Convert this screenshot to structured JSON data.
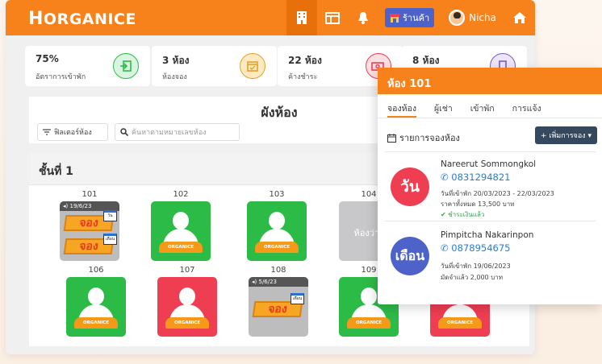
{
  "app": {
    "logo_h": "H",
    "logo_rest": "ORGANICE"
  },
  "nav": {
    "shop_label": "ร้านค้า",
    "user_name": "Nicha"
  },
  "stats": [
    {
      "value": "75%",
      "label": "อัตราการเข้าพัก",
      "color": "#2dbb47"
    },
    {
      "value": "3 ห้อง",
      "label": "ห้องจอง",
      "color": "#e5a21c"
    },
    {
      "value": "22 ห้อง",
      "label": "ค้างชำระ",
      "color": "#ef3d52"
    },
    {
      "value": "8 ห้อง",
      "label": "",
      "color": "#7b5cc4"
    }
  ],
  "plan": {
    "title": "ผังห้อง",
    "filter_label": "ฟิลเตอร์ห้อง",
    "search_placeholder": "ค้นหาตามหมายเลขห้อง"
  },
  "floor": {
    "title": "ชั้นที่ 1"
  },
  "rooms": [
    {
      "num": "101",
      "status": "booked",
      "date": "19/6/23",
      "booking_1": "จอง",
      "cal_1": "วัน",
      "booking_2": "จอง",
      "cal_2": "เดือน"
    },
    {
      "num": "102",
      "status": "occupied",
      "badge": "ORGANICE"
    },
    {
      "num": "103",
      "status": "occupied",
      "badge": "ORGANICE"
    },
    {
      "num": "104",
      "status": "vacant",
      "label": "ห้องว่าง"
    },
    {
      "num": "106",
      "status": "occupied",
      "badge": "ORGANICE"
    },
    {
      "num": "107",
      "status": "overdue",
      "badge": "ORGANICE"
    },
    {
      "num": "108",
      "status": "booked",
      "date": "5/6/23",
      "booking_1": "จอง",
      "cal_1": "เดือน"
    },
    {
      "num": "109",
      "status": "occupied",
      "badge": "ORGANICE"
    },
    {
      "num": "",
      "status": "overdue",
      "badge": "ORGANICE"
    }
  ],
  "panel": {
    "title": "ห้อง 101",
    "tabs": [
      "จองห้อง",
      "ผู้เช่า",
      "เข้าพัก",
      "การแจ้ง"
    ],
    "list_title": "รายการจองห้อง",
    "add_label": "+ เพิ่มการจอง ▾",
    "bookings": [
      {
        "badge": "วัน",
        "badge_color": "#ef3d52",
        "name": "Nareerut Sommongkol",
        "phone": "0831294821",
        "line1": "วันที่เข้าพัก 20/03/2023 - 22/03/2023",
        "line2": "ราคาทั้งหมด 13,500 บาท",
        "paid": "ชำระเงินแล้ว"
      },
      {
        "badge": "เดือน",
        "badge_color": "#4d63c9",
        "name": "Pimpitcha Nakarinpon",
        "phone": "0878954675",
        "line1": "วันที่เข้าพัก 19/06/2023",
        "line2": "มัดจำแล้ว 2,000 บาท"
      }
    ]
  }
}
